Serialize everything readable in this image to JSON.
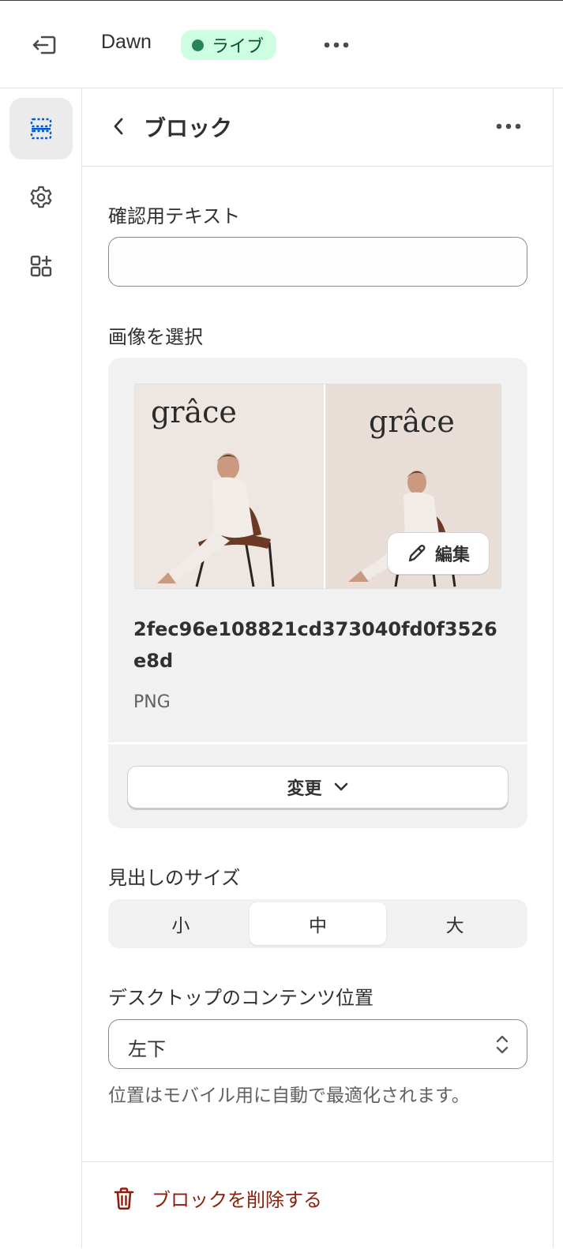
{
  "topbar": {
    "theme_name": "Dawn",
    "status_badge": "ライブ"
  },
  "sidenav": {
    "items": [
      {
        "icon": "sections-icon",
        "active": true
      },
      {
        "icon": "settings-gear-icon",
        "active": false
      },
      {
        "icon": "app-blocks-icon",
        "active": false
      }
    ]
  },
  "panel": {
    "title": "ブロック",
    "confirm_text": {
      "label": "確認用テキスト",
      "value": "",
      "placeholder": ""
    },
    "image": {
      "label": "画像を選択",
      "edit_label": "編集",
      "file_name": "2fec96e108821cd373040fd0f3526e8d",
      "file_type": "PNG",
      "change_label": "変更",
      "logo_text": "grâce"
    },
    "heading_size": {
      "label": "見出しのサイズ",
      "options": [
        "小",
        "中",
        "大"
      ],
      "selected": "中"
    },
    "desktop_position": {
      "label": "デスクトップのコンテンツ位置",
      "value": "左下",
      "help": "位置はモバイル用に自動で最適化されます。"
    },
    "delete_label": "ブロックを削除する"
  },
  "colors": {
    "live_badge_bg": "#cdfee1",
    "live_dot": "#29845a",
    "active_nav_icon": "#005bd3",
    "danger": "#8e1f0b"
  }
}
